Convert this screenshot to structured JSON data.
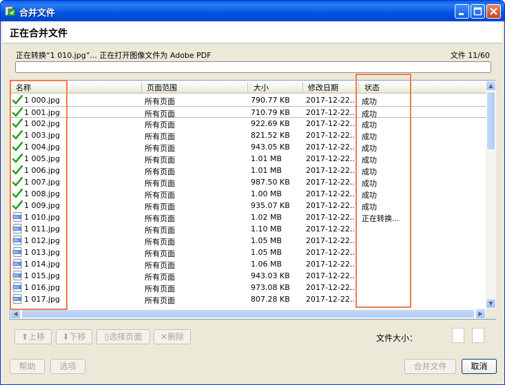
{
  "window": {
    "title": "合并文件",
    "colors": {
      "titlebar": "#0054e3",
      "highlight": "#f07850",
      "check": "#1ea51e"
    }
  },
  "header": {
    "title": "正在合并文件"
  },
  "status": {
    "text": "正在转换“1 010.jpg”... 正在打开图像文件为 Adobe PDF",
    "file_count": "文件 11/60"
  },
  "columns": [
    "名称",
    "页面范围",
    "大小",
    "修改日期",
    "状态"
  ],
  "rows": [
    {
      "name": "1 000.jpg",
      "range": "所有页面",
      "size": "790.77 KB",
      "date": "2017-12-22...",
      "status": "成功",
      "icon": "check-icon"
    },
    {
      "name": "1 001.jpg",
      "range": "所有页面",
      "size": "710.79 KB",
      "date": "2017-12-22...",
      "status": "成功",
      "icon": "check-icon"
    },
    {
      "name": "1 002.jpg",
      "range": "所有页面",
      "size": "922.69 KB",
      "date": "2017-12-22...",
      "status": "成功",
      "icon": "check-icon"
    },
    {
      "name": "1 003.jpg",
      "range": "所有页面",
      "size": "821.52 KB",
      "date": "2017-12-22...",
      "status": "成功",
      "icon": "check-icon"
    },
    {
      "name": "1 004.jpg",
      "range": "所有页面",
      "size": "943.05 KB",
      "date": "2017-12-22...",
      "status": "成功",
      "icon": "check-icon"
    },
    {
      "name": "1 005.jpg",
      "range": "所有页面",
      "size": "1.01 MB",
      "date": "2017-12-22...",
      "status": "成功",
      "icon": "check-icon"
    },
    {
      "name": "1 006.jpg",
      "range": "所有页面",
      "size": "1.01 MB",
      "date": "2017-12-22...",
      "status": "成功",
      "icon": "check-icon"
    },
    {
      "name": "1 007.jpg",
      "range": "所有页面",
      "size": "987.50 KB",
      "date": "2017-12-22...",
      "status": "成功",
      "icon": "check-icon"
    },
    {
      "name": "1 008.jpg",
      "range": "所有页面",
      "size": "1.00 MB",
      "date": "2017-12-22...",
      "status": "成功",
      "icon": "check-icon"
    },
    {
      "name": "1 009.jpg",
      "range": "所有页面",
      "size": "935.07 KB",
      "date": "2017-12-22...",
      "status": "成功",
      "icon": "check-icon"
    },
    {
      "name": "1 010.jpg",
      "range": "所有页面",
      "size": "1.02 MB",
      "date": "2017-12-22...",
      "status": "正在转换...",
      "icon": "jpeg-file-icon"
    },
    {
      "name": "1 011.jpg",
      "range": "所有页面",
      "size": "1.10 MB",
      "date": "2017-12-22...",
      "status": "",
      "icon": "jpeg-file-icon"
    },
    {
      "name": "1 012.jpg",
      "range": "所有页面",
      "size": "1.05 MB",
      "date": "2017-12-22...",
      "status": "",
      "icon": "jpeg-file-icon"
    },
    {
      "name": "1 013.jpg",
      "range": "所有页面",
      "size": "1.05 MB",
      "date": "2017-12-22...",
      "status": "",
      "icon": "jpeg-file-icon"
    },
    {
      "name": "1 014.jpg",
      "range": "所有页面",
      "size": "1.06 MB",
      "date": "2017-12-22...",
      "status": "",
      "icon": "jpeg-file-icon"
    },
    {
      "name": "1 015.jpg",
      "range": "所有页面",
      "size": "943.03 KB",
      "date": "2017-12-22...",
      "status": "",
      "icon": "jpeg-file-icon"
    },
    {
      "name": "1 016.jpg",
      "range": "所有页面",
      "size": "973.08 KB",
      "date": "2017-12-22...",
      "status": "",
      "icon": "jpeg-file-icon"
    },
    {
      "name": "1 017.jpg",
      "range": "所有页面",
      "size": "807.28 KB",
      "date": "2017-12-22...",
      "status": "",
      "icon": "jpeg-file-icon"
    }
  ],
  "toolbar": {
    "up": "上移",
    "down": "下移",
    "select_pages": "选择页面",
    "delete": "删除",
    "file_size_label": "文件大小："
  },
  "footer": {
    "help": "帮助",
    "options": "选项",
    "merge": "合并文件",
    "cancel": "取消"
  }
}
